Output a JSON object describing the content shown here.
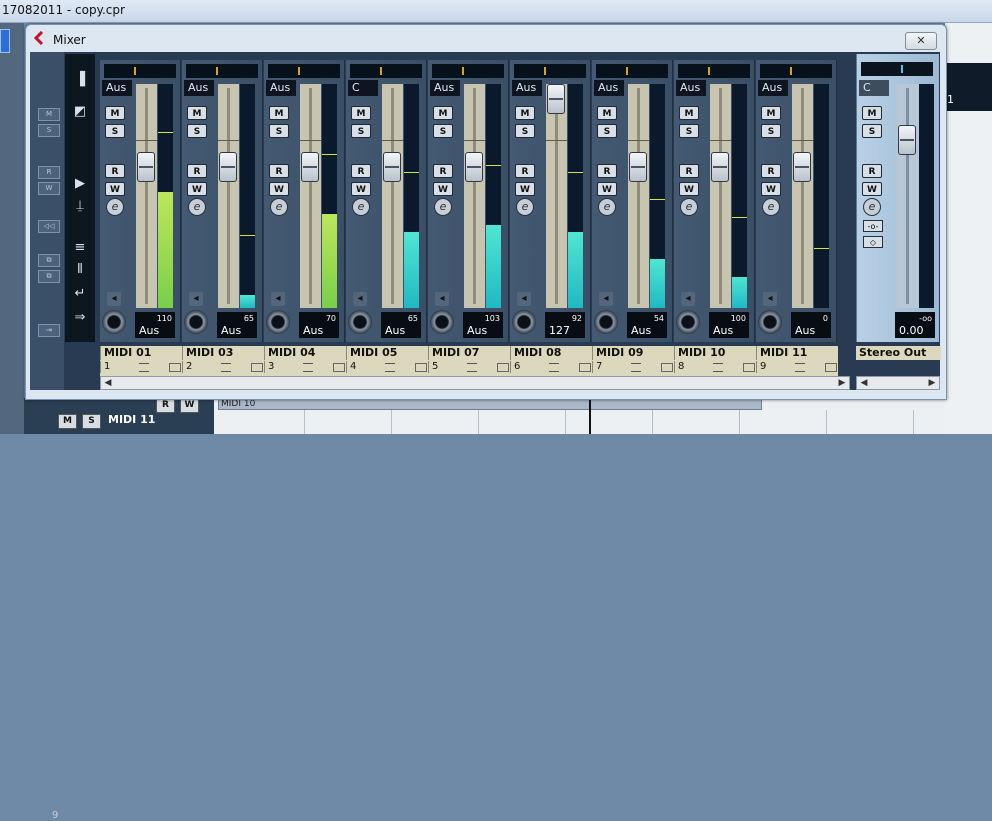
{
  "app": {
    "window_title": "17082011 - copy.cpr",
    "mixer_title": "Mixer"
  },
  "colors": {
    "meter": "#27c5c9",
    "meter_green": "#9fdf52",
    "name_bar": "#dcd8bd"
  },
  "left_icons": [
    "m-icon",
    "s-icon",
    "r-icon",
    "w-icon",
    "bypass-icon",
    "copy-icon",
    "paste-icon",
    "route-icon"
  ],
  "toolstrip": [
    "panel-icon",
    "layout-icon",
    "cursor-icon",
    "insert-icon",
    "list-icon",
    "eq-icon",
    "return-icon",
    "export-icon"
  ],
  "channels": [
    {
      "name": "MIDI 01",
      "num": "1",
      "route": "Aus",
      "value": "110",
      "label": "Aus",
      "fader": 0.65,
      "meter": 0.52,
      "green": true
    },
    {
      "name": "MIDI 03",
      "num": "2",
      "route": "Aus",
      "value": "65",
      "label": "Aus",
      "fader": 0.65,
      "meter": 0.06,
      "green": false
    },
    {
      "name": "MIDI 04",
      "num": "3",
      "route": "Aus",
      "value": "70",
      "label": "Aus",
      "fader": 0.65,
      "meter": 0.42,
      "green": true
    },
    {
      "name": "MIDI 05",
      "num": "4",
      "route": "C",
      "value": "65",
      "label": "Aus",
      "fader": 0.65,
      "meter": 0.34,
      "green": false
    },
    {
      "name": "MIDI 07",
      "num": "5",
      "route": "Aus",
      "value": "103",
      "label": "Aus",
      "fader": 0.65,
      "meter": 0.37,
      "green": false
    },
    {
      "name": "MIDI 08",
      "num": "6",
      "route": "Aus",
      "value": "92",
      "label": "127",
      "fader": 1.0,
      "meter": 0.34,
      "green": false
    },
    {
      "name": "MIDI 09",
      "num": "7",
      "route": "Aus",
      "value": "54",
      "label": "Aus",
      "fader": 0.65,
      "meter": 0.22,
      "green": false
    },
    {
      "name": "MIDI 10",
      "num": "8",
      "route": "Aus",
      "value": "100",
      "label": "Aus",
      "fader": 0.65,
      "meter": 0.14,
      "green": false
    },
    {
      "name": "MIDI 11",
      "num": "9",
      "route": "Aus",
      "value": "0",
      "label": "Aus",
      "fader": 0.65,
      "meter": 0.0,
      "green": false
    }
  ],
  "master": {
    "name": "Stereo Out",
    "route": "C",
    "value": "-oo",
    "label": "0.00",
    "fader": 0.79
  },
  "buttons": {
    "mute": "M",
    "solo": "S",
    "read": "R",
    "write": "W",
    "edit": "e"
  },
  "arrange": {
    "track_number": "9",
    "track_name": "MIDI 11",
    "part_label": "MIDI 10",
    "right_marker": "1"
  }
}
